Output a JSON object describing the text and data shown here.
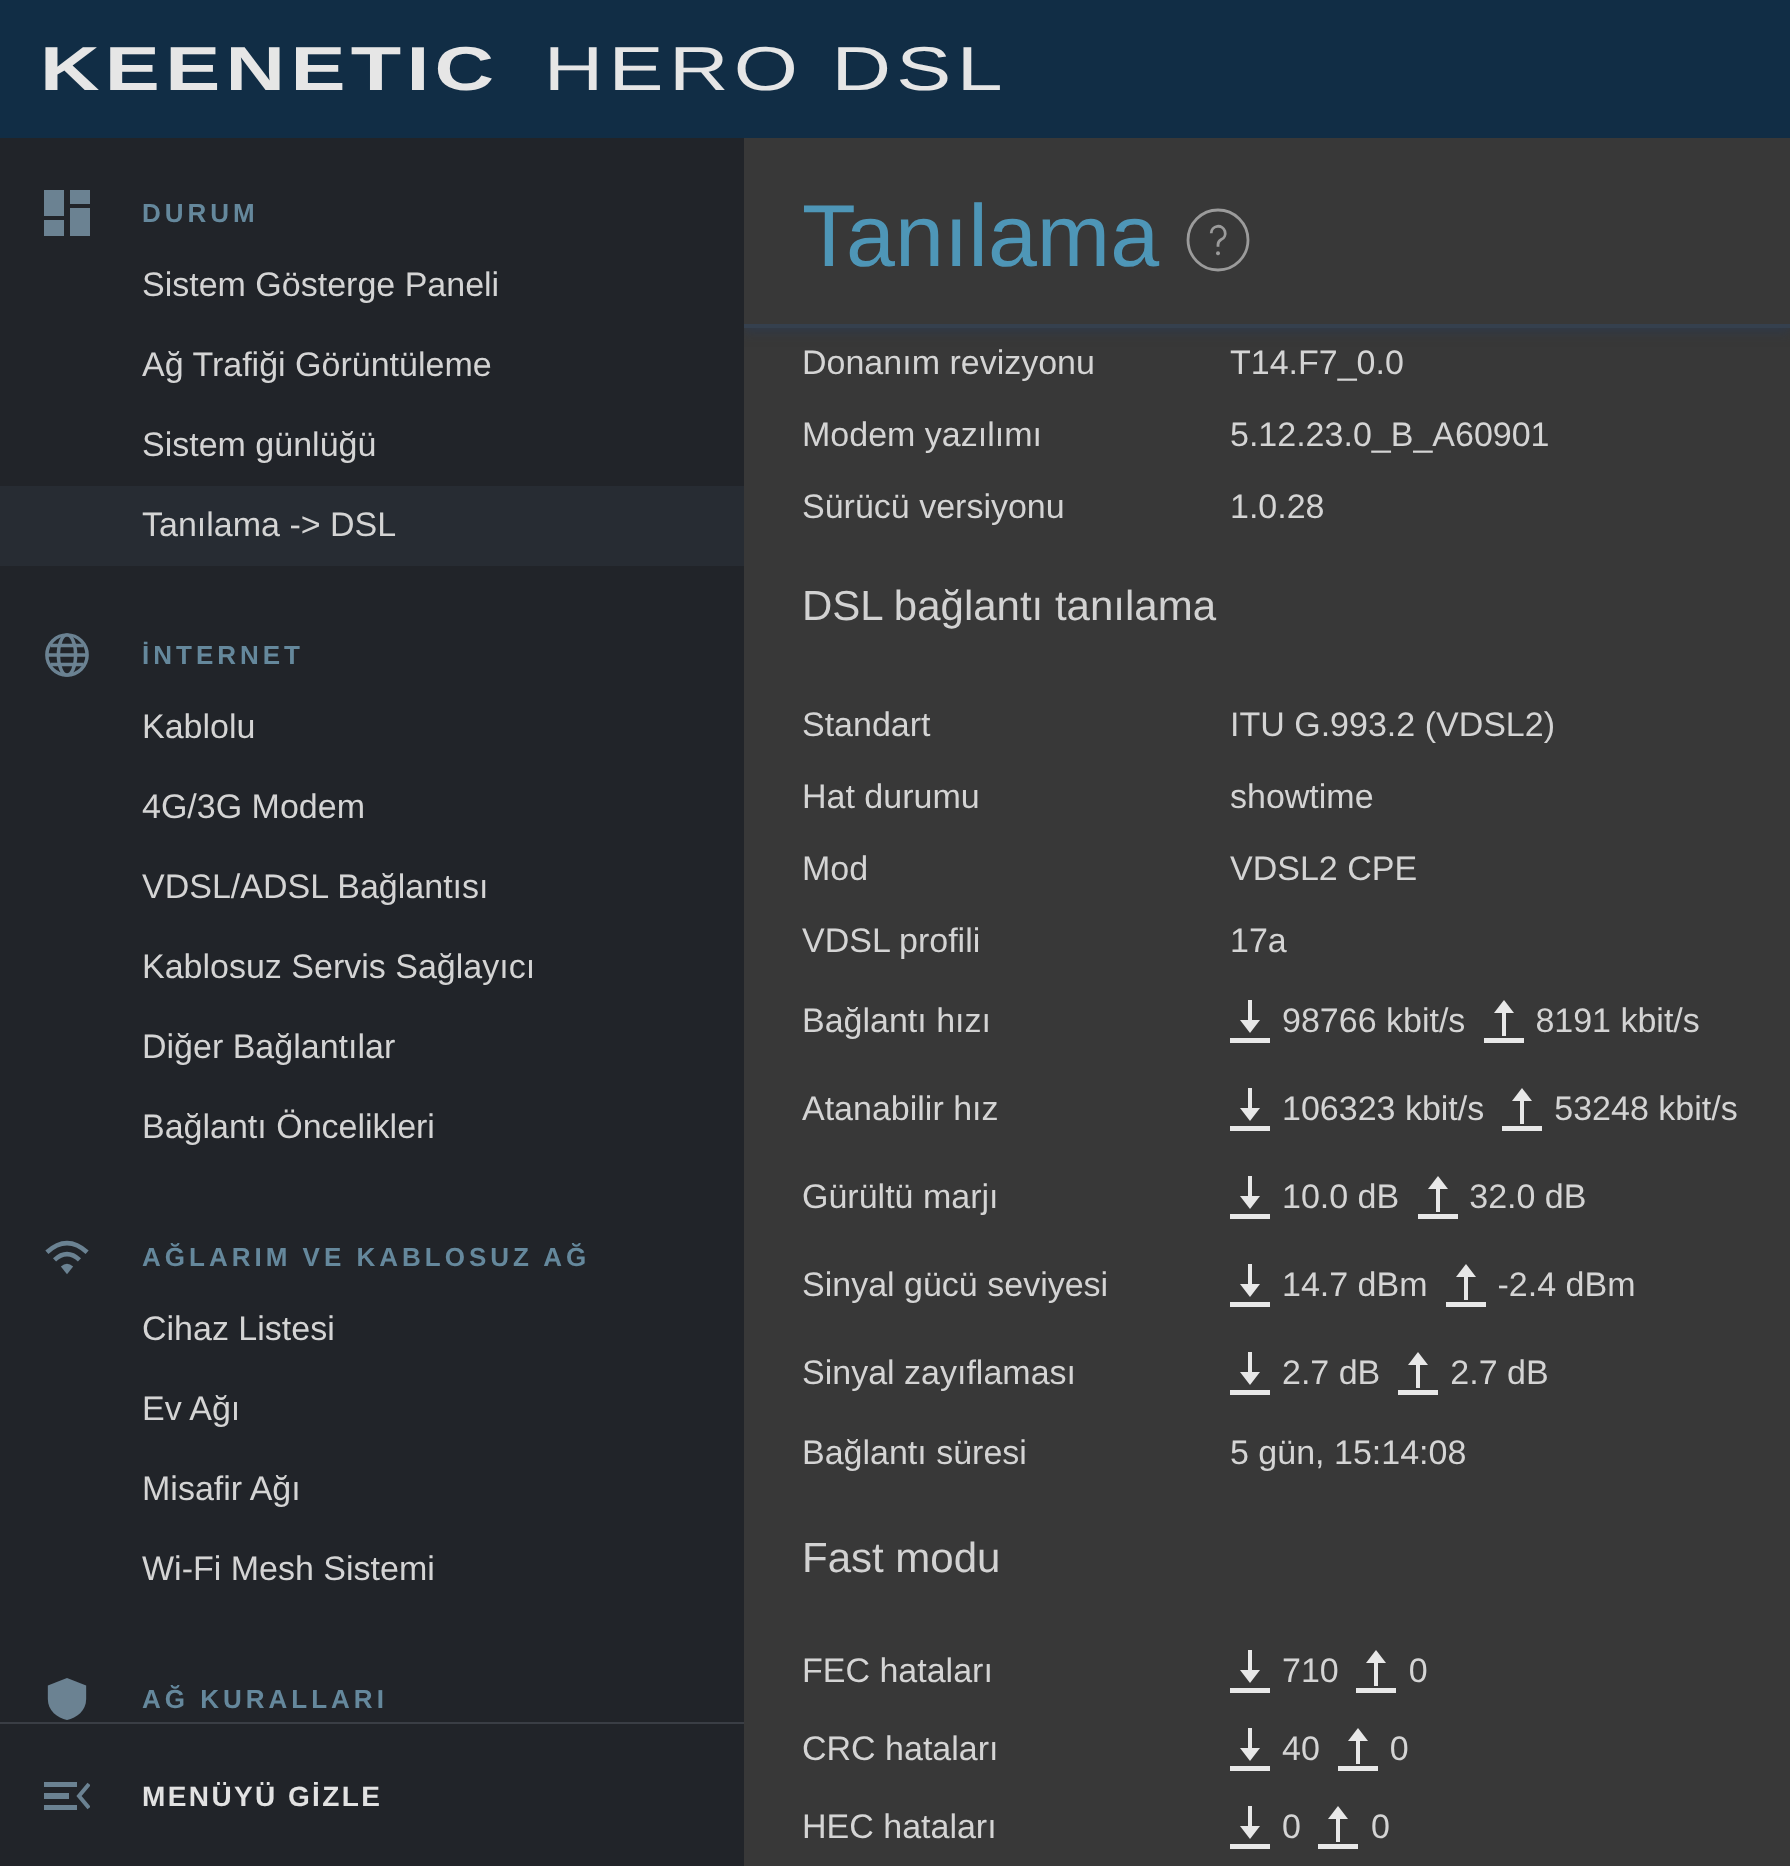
{
  "header": {
    "brand": "KEENETIC",
    "model": "HERO DSL"
  },
  "sidebar": {
    "sections": [
      {
        "title": "DURUM",
        "items": [
          {
            "label": "Sistem Gösterge Paneli",
            "selected": false
          },
          {
            "label": "Ağ Trafiği Görüntüleme",
            "selected": false
          },
          {
            "label": "Sistem günlüğü",
            "selected": false
          },
          {
            "label": "Tanılama -> DSL",
            "selected": true
          }
        ]
      },
      {
        "title": "İNTERNET",
        "items": [
          {
            "label": "Kablolu",
            "selected": false
          },
          {
            "label": "4G/3G Modem",
            "selected": false
          },
          {
            "label": "VDSL/ADSL Bağlantısı",
            "selected": false
          },
          {
            "label": "Kablosuz Servis Sağlayıcı",
            "selected": false
          },
          {
            "label": "Diğer Bağlantılar",
            "selected": false
          },
          {
            "label": "Bağlantı Öncelikleri",
            "selected": false
          }
        ]
      },
      {
        "title": "AĞLARIM VE KABLOSUZ AĞ",
        "items": [
          {
            "label": "Cihaz Listesi",
            "selected": false
          },
          {
            "label": "Ev Ağı",
            "selected": false
          },
          {
            "label": "Misafir Ağı",
            "selected": false
          },
          {
            "label": "Wi-Fi Mesh Sistemi",
            "selected": false
          }
        ]
      },
      {
        "title": "AĞ KURALLARI"
      }
    ],
    "footer_button": "MENÜYÜ GİZLE"
  },
  "main": {
    "title": "Tanılama",
    "groups": [
      {
        "rows": [
          {
            "kind": "text",
            "label": "Donanım revizyonu",
            "value": "T14.F7_0.0"
          },
          {
            "kind": "text",
            "label": "Modem yazılımı",
            "value": "5.12.23.0_B_A60901"
          },
          {
            "kind": "text",
            "label": "Sürücü versiyonu",
            "value": "1.0.28"
          }
        ]
      },
      {
        "heading": "DSL bağlantı tanılama",
        "rows": [
          {
            "kind": "text",
            "label": "Standart",
            "value": "ITU G.993.2 (VDSL2)"
          },
          {
            "kind": "text",
            "label": "Hat durumu",
            "value": "showtime"
          },
          {
            "kind": "text",
            "label": "Mod",
            "value": "VDSL2 CPE"
          },
          {
            "kind": "text",
            "label": "VDSL profili",
            "value": "17a"
          },
          {
            "kind": "updown",
            "label": "Bağlantı hızı",
            "down": "98766 kbit/s",
            "up": "8191 kbit/s"
          },
          {
            "kind": "updown",
            "label": "Atanabilir hız",
            "down": "106323 kbit/s",
            "up": "53248 kbit/s"
          },
          {
            "kind": "updown",
            "label": "Gürültü marjı",
            "down": "10.0 dB",
            "up": "32.0 dB"
          },
          {
            "kind": "updown",
            "label": "Sinyal gücü seviyesi",
            "down": "14.7 dBm",
            "up": "-2.4 dBm"
          },
          {
            "kind": "updown",
            "label": "Sinyal zayıflaması",
            "down": "2.7 dB",
            "up": "2.7 dB"
          },
          {
            "kind": "text",
            "label": "Bağlantı süresi",
            "value": "5 gün, 15:14:08"
          }
        ]
      },
      {
        "heading": "Fast modu",
        "rows": [
          {
            "kind": "updown",
            "label": "FEC hataları",
            "down": "710",
            "up": "0"
          },
          {
            "kind": "updown",
            "label": "CRC hataları",
            "down": "40",
            "up": "0"
          },
          {
            "kind": "updown",
            "label": "HEC hataları",
            "down": "0",
            "up": "0"
          }
        ]
      }
    ]
  }
}
